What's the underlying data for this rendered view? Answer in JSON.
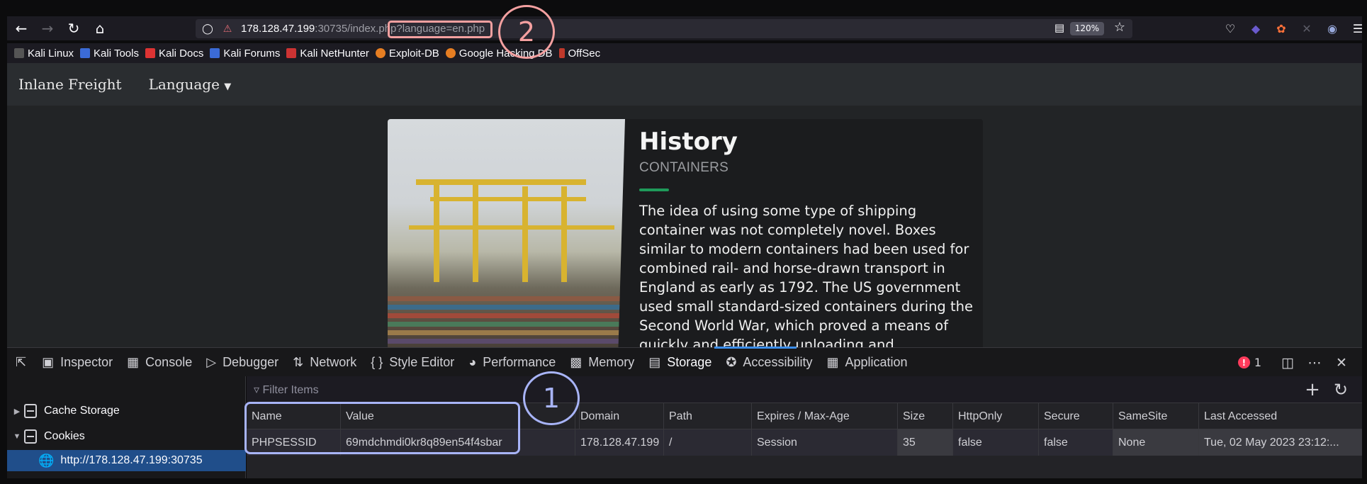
{
  "browser": {
    "url_host": "178.128.47.199",
    "url_rest": ":30735/index.php?language=en.php",
    "zoom": "120%",
    "bookmarks": [
      "Kali Linux",
      "Kali Tools",
      "Kali Docs",
      "Kali Forums",
      "Kali NetHunter",
      "Exploit-DB",
      "Google Hacking DB",
      "OffSec"
    ]
  },
  "site": {
    "brand": "Inlane Freight",
    "language_menu": "Language",
    "heading": "History",
    "subheading": "CONTAINERS",
    "body": "The idea of using some type of shipping container was not completely novel. Boxes similar to modern containers had been used for combined rail- and horse-drawn transport in England as early as 1792. The US government used small standard-sized containers during the Second World War, which proved a means of quickly and efficiently unloading and"
  },
  "devtools": {
    "tabs": [
      "Inspector",
      "Console",
      "Debugger",
      "Network",
      "Style Editor",
      "Performance",
      "Memory",
      "Storage",
      "Accessibility",
      "Application"
    ],
    "active_tab": "Storage",
    "error_count": "1",
    "filter_placeholder": "Filter Items",
    "tree": [
      "Cache Storage",
      "Cookies",
      "http://178.128.47.199:30735"
    ],
    "columns": [
      "Name",
      "Value",
      "Domain",
      "Path",
      "Expires / Max-Age",
      "Size",
      "HttpOnly",
      "Secure",
      "SameSite",
      "Last Accessed"
    ],
    "rows": [
      [
        "PHPSESSID",
        "69mdchmdi0kr8q89en54f4sbar",
        "178.128.47.199",
        "/",
        "Session",
        "35",
        "false",
        "false",
        "None",
        "Tue, 02 May 2023 23:12:..."
      ]
    ]
  },
  "annotations": [
    "1",
    "2"
  ],
  "colors": {
    "annotation_blue": "#a8b4f8",
    "annotation_red": "#f4a0a0",
    "active_tab_line": "#3b8eea",
    "selected_row": "#204e8a"
  }
}
